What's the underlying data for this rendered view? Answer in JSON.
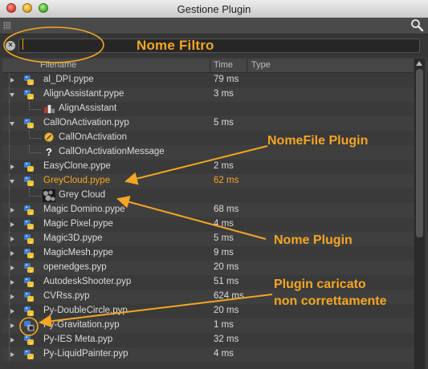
{
  "window": {
    "title": "Gestione Plugin"
  },
  "filter": {
    "value": "",
    "placeholder": ""
  },
  "columns": {
    "filename": "Filename",
    "time": "Time",
    "type": "Type"
  },
  "rows": [
    {
      "kind": "plugin",
      "expanded": false,
      "name": "al_DPI.pype",
      "time": "79 ms"
    },
    {
      "kind": "plugin",
      "expanded": true,
      "name": "AlignAssistant.pype",
      "time": "3 ms"
    },
    {
      "kind": "child",
      "icon": "align-assistant-icon",
      "name": "AlignAssistant",
      "time": ""
    },
    {
      "kind": "plugin",
      "expanded": true,
      "name": "CallOnActivation.pyp",
      "time": "5 ms"
    },
    {
      "kind": "child",
      "icon": "warning-icon",
      "name": "CallOnActivation",
      "time": ""
    },
    {
      "kind": "child",
      "icon": "question-icon",
      "name": "CallOnActivationMessage",
      "time": ""
    },
    {
      "kind": "plugin",
      "expanded": false,
      "name": "EasyClone.pype",
      "time": "2 ms"
    },
    {
      "kind": "plugin",
      "expanded": true,
      "name": "GreyCloud.pype",
      "time": "62 ms",
      "selected": true
    },
    {
      "kind": "child",
      "icon": "cloud-texture-icon",
      "name": "Grey Cloud",
      "time": ""
    },
    {
      "kind": "plugin",
      "expanded": false,
      "name": "Magic Domino.pype",
      "time": "68 ms"
    },
    {
      "kind": "plugin",
      "expanded": false,
      "name": "Magic Pixel.pype",
      "time": "4 ms"
    },
    {
      "kind": "plugin",
      "expanded": false,
      "name": "Magic3D.pype",
      "time": "5 ms"
    },
    {
      "kind": "plugin",
      "expanded": false,
      "name": "MagicMesh.pype",
      "time": "9 ms"
    },
    {
      "kind": "plugin",
      "expanded": false,
      "name": "openedges.pyp",
      "time": "20 ms"
    },
    {
      "kind": "plugin",
      "expanded": false,
      "name": "AutodeskShooter.pyp",
      "time": "51 ms"
    },
    {
      "kind": "plugin",
      "expanded": false,
      "name": "CVRss.pyp",
      "time": "624 ms"
    },
    {
      "kind": "plugin",
      "expanded": false,
      "name": "Py-DoubleCircle.pyp",
      "time": "20 ms"
    },
    {
      "kind": "plugin",
      "expanded": false,
      "name": "Py-Gravitation.pyp",
      "time": "1 ms",
      "error": true
    },
    {
      "kind": "plugin",
      "expanded": false,
      "name": "Py-IES Meta.pyp",
      "time": "32 ms"
    },
    {
      "kind": "plugin",
      "expanded": false,
      "name": "Py-LiquidPainter.pyp",
      "time": "4 ms"
    }
  ],
  "annotations": {
    "filter_name": "Nome Filtro",
    "plugin_filename": "NomeFile Plugin",
    "plugin_name": "Nome Plugin",
    "load_error_line1": "Plugin caricato",
    "load_error_line2": "non correttamente"
  },
  "colors": {
    "annotation": "#f5a623",
    "selected_text": "#f5a623",
    "python_blue": "#3d7fd6",
    "python_yellow": "#f2c230"
  }
}
